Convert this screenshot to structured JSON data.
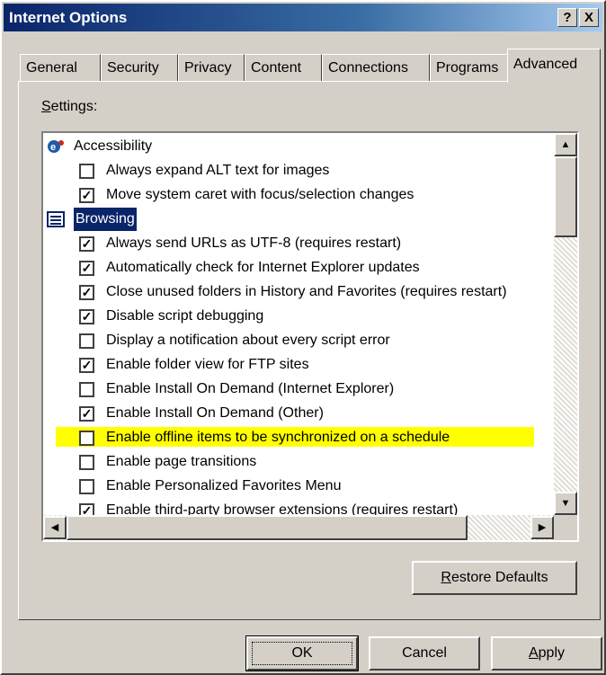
{
  "window": {
    "title": "Internet Options",
    "help_label": "?",
    "close_label": "X"
  },
  "tabs": [
    {
      "label": "General"
    },
    {
      "label": "Security"
    },
    {
      "label": "Privacy"
    },
    {
      "label": "Content"
    },
    {
      "label": "Connections"
    },
    {
      "label": "Programs"
    },
    {
      "label": "Advanced",
      "active": true
    }
  ],
  "settings": {
    "label_first": "S",
    "label_rest": "ettings:",
    "items": [
      {
        "type": "category",
        "icon": "accessibility-icon",
        "label": "Accessibility"
      },
      {
        "type": "checkbox",
        "checked": false,
        "label": "Always expand ALT text for images"
      },
      {
        "type": "checkbox",
        "checked": true,
        "label": "Move system caret with focus/selection changes"
      },
      {
        "type": "category",
        "icon": "browsing-icon",
        "label": "Browsing",
        "selected": true
      },
      {
        "type": "checkbox",
        "checked": true,
        "label": "Always send URLs as UTF-8 (requires restart)"
      },
      {
        "type": "checkbox",
        "checked": true,
        "label": "Automatically check for Internet Explorer updates"
      },
      {
        "type": "checkbox",
        "checked": true,
        "label": "Close unused folders in History and Favorites (requires restart)"
      },
      {
        "type": "checkbox",
        "checked": true,
        "label": "Disable script debugging"
      },
      {
        "type": "checkbox",
        "checked": false,
        "label": "Display a notification about every script error"
      },
      {
        "type": "checkbox",
        "checked": true,
        "label": "Enable folder view for FTP sites"
      },
      {
        "type": "checkbox",
        "checked": false,
        "label": "Enable Install On Demand (Internet Explorer)"
      },
      {
        "type": "checkbox",
        "checked": true,
        "label": "Enable Install On Demand (Other)"
      },
      {
        "type": "checkbox",
        "checked": false,
        "label": "Enable offline items to be synchronized on a schedule",
        "highlight": "#ffff00"
      },
      {
        "type": "checkbox",
        "checked": false,
        "label": "Enable page transitions"
      },
      {
        "type": "checkbox",
        "checked": false,
        "label": "Enable Personalized Favorites Menu"
      },
      {
        "type": "checkbox",
        "checked": true,
        "label": "Enable third-party browser extensions (requires restart)"
      }
    ]
  },
  "scrollbar": {
    "up": "▲",
    "down": "▼",
    "left": "◀",
    "right": "▶"
  },
  "buttons": {
    "restore_first": "R",
    "restore_rest": "estore Defaults",
    "ok": "OK",
    "cancel": "Cancel",
    "apply_first": "A",
    "apply_rest": "pply"
  },
  "colors": {
    "titlebar_start": "#0a246a",
    "titlebar_end": "#a6caf0",
    "face": "#d4d0c8",
    "highlight": "#ffff00"
  }
}
